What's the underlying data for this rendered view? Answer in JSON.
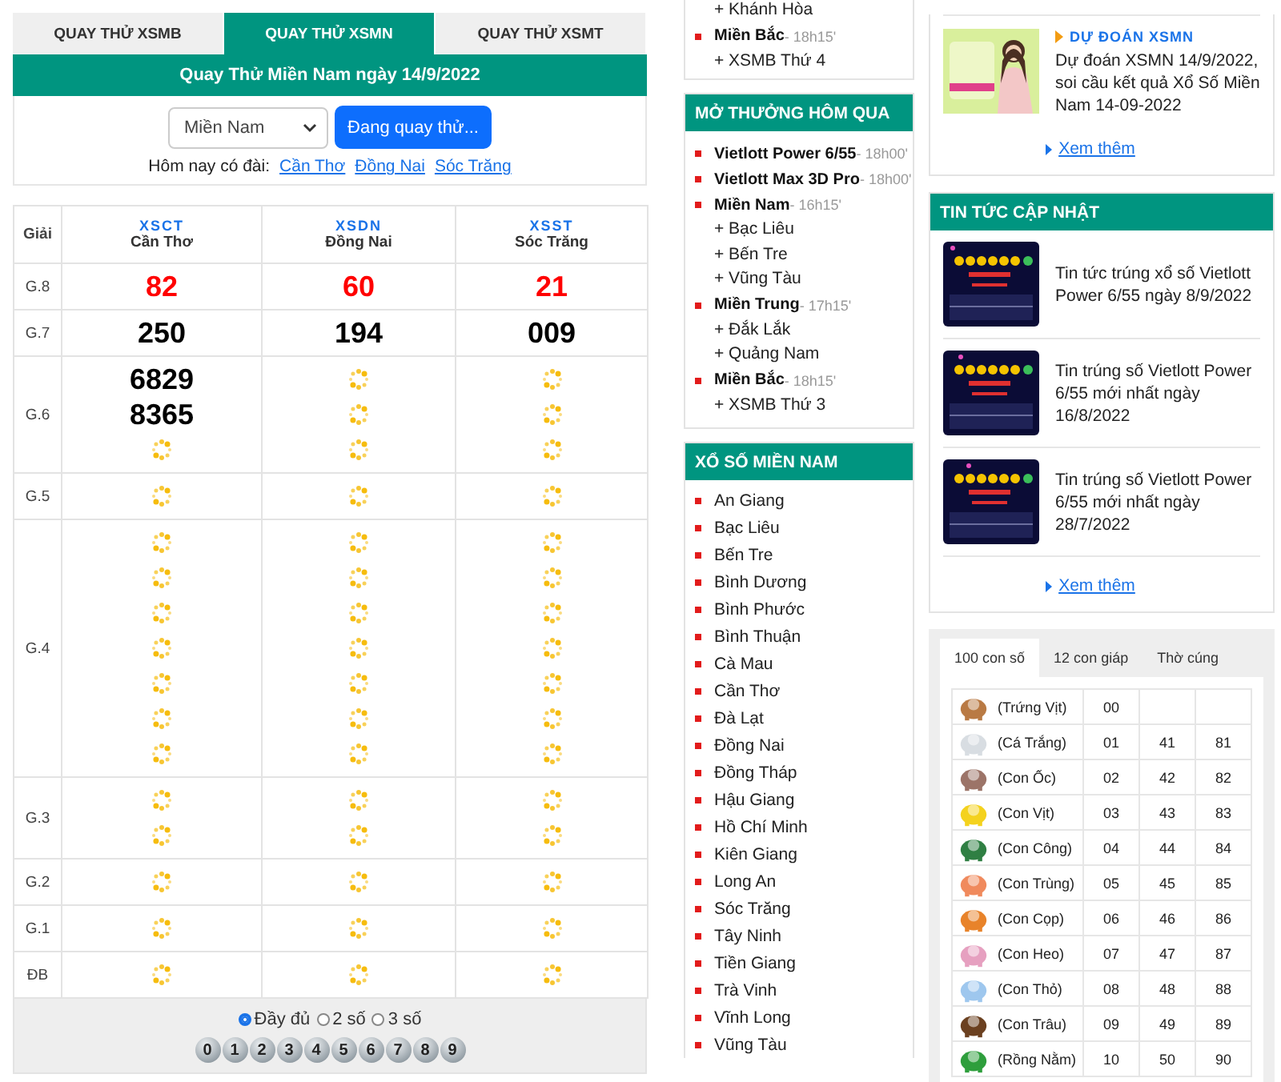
{
  "tabs": [
    {
      "label": "QUAY THỬ XSMB",
      "selected": false
    },
    {
      "label": "QUAY THỬ XSMN",
      "selected": true
    },
    {
      "label": "QUAY THỬ XSMT",
      "selected": false
    }
  ],
  "title": "Quay Thử Miền Nam ngày 14/9/2022",
  "region_select": {
    "value": "Miền Nam"
  },
  "spin_button": "Đang quay thử...",
  "today": {
    "label": "Hôm nay có đài:",
    "links": [
      "Cần Thơ",
      "Đồng Nai",
      "Sóc Trăng"
    ]
  },
  "results": {
    "corner": "Giải",
    "columns": [
      {
        "code": "XSCT",
        "name": "Cần Thơ"
      },
      {
        "code": "XSDN",
        "name": "Đồng Nai"
      },
      {
        "code": "XSST",
        "name": "Sóc Trăng"
      }
    ],
    "rows": [
      {
        "label": "G.8",
        "highlight": true,
        "cells": [
          [
            {
              "kind": "number",
              "text": "82"
            }
          ],
          [
            {
              "kind": "number",
              "text": "60"
            }
          ],
          [
            {
              "kind": "number",
              "text": "21"
            }
          ]
        ]
      },
      {
        "label": "G.7",
        "highlight": false,
        "cells": [
          [
            {
              "kind": "number",
              "text": "250"
            }
          ],
          [
            {
              "kind": "number",
              "text": "194"
            }
          ],
          [
            {
              "kind": "number",
              "text": "009"
            }
          ]
        ]
      },
      {
        "label": "G.6",
        "highlight": false,
        "cells": [
          [
            {
              "kind": "number",
              "text": "6829"
            },
            {
              "kind": "number",
              "text": "8365"
            },
            {
              "kind": "pending"
            }
          ],
          [
            {
              "kind": "pending"
            },
            {
              "kind": "pending"
            },
            {
              "kind": "pending"
            }
          ],
          [
            {
              "kind": "pending"
            },
            {
              "kind": "pending"
            },
            {
              "kind": "pending"
            }
          ]
        ]
      },
      {
        "label": "G.5",
        "highlight": false,
        "cells": [
          [
            {
              "kind": "pending"
            }
          ],
          [
            {
              "kind": "pending"
            }
          ],
          [
            {
              "kind": "pending"
            }
          ]
        ]
      },
      {
        "label": "G.4",
        "highlight": false,
        "cells": [
          [
            {
              "kind": "pending"
            },
            {
              "kind": "pending"
            },
            {
              "kind": "pending"
            },
            {
              "kind": "pending"
            },
            {
              "kind": "pending"
            },
            {
              "kind": "pending"
            },
            {
              "kind": "pending"
            }
          ],
          [
            {
              "kind": "pending"
            },
            {
              "kind": "pending"
            },
            {
              "kind": "pending"
            },
            {
              "kind": "pending"
            },
            {
              "kind": "pending"
            },
            {
              "kind": "pending"
            },
            {
              "kind": "pending"
            }
          ],
          [
            {
              "kind": "pending"
            },
            {
              "kind": "pending"
            },
            {
              "kind": "pending"
            },
            {
              "kind": "pending"
            },
            {
              "kind": "pending"
            },
            {
              "kind": "pending"
            },
            {
              "kind": "pending"
            }
          ]
        ]
      },
      {
        "label": "G.3",
        "highlight": false,
        "cells": [
          [
            {
              "kind": "pending"
            },
            {
              "kind": "pending"
            }
          ],
          [
            {
              "kind": "pending"
            },
            {
              "kind": "pending"
            }
          ],
          [
            {
              "kind": "pending"
            },
            {
              "kind": "pending"
            }
          ]
        ]
      },
      {
        "label": "G.2",
        "highlight": false,
        "cells": [
          [
            {
              "kind": "pending"
            }
          ],
          [
            {
              "kind": "pending"
            }
          ],
          [
            {
              "kind": "pending"
            }
          ]
        ]
      },
      {
        "label": "G.1",
        "highlight": false,
        "cells": [
          [
            {
              "kind": "pending"
            }
          ],
          [
            {
              "kind": "pending"
            }
          ],
          [
            {
              "kind": "pending"
            }
          ]
        ]
      },
      {
        "label": "ĐB",
        "highlight": false,
        "cells": [
          [
            {
              "kind": "pending"
            }
          ],
          [
            {
              "kind": "pending"
            }
          ],
          [
            {
              "kind": "pending"
            }
          ]
        ]
      }
    ]
  },
  "display_options": [
    {
      "label": "Đầy đủ",
      "selected": true
    },
    {
      "label": "2 số",
      "selected": false
    },
    {
      "label": "3 số",
      "selected": false
    }
  ],
  "digit_balls": [
    "0",
    "1",
    "2",
    "3",
    "4",
    "5",
    "6",
    "7",
    "8",
    "9"
  ],
  "schedule_today": {
    "groups": [
      {
        "children": [
          "+ Khánh Hòa"
        ]
      },
      {
        "title": "Miền Bắc",
        "time": "- 18h15'",
        "children": [
          "+ XSMB Thứ 4"
        ]
      }
    ]
  },
  "yesterday": {
    "heading": "MỞ THƯỞNG HÔM QUA",
    "groups": [
      {
        "title": "Vietlott Power 6/55",
        "time": "- 18h00'"
      },
      {
        "title": "Vietlott Max 3D Pro",
        "time": "- 18h00'"
      },
      {
        "title": "Miền Nam",
        "time": "- 16h15'",
        "children": [
          "+ Bạc Liêu",
          "+ Bến Tre",
          "+ Vũng Tàu"
        ]
      },
      {
        "title": "Miền Trung",
        "time": "- 17h15'",
        "children": [
          "+ Đắk Lắk",
          "+ Quảng Nam"
        ]
      },
      {
        "title": "Miền Bắc",
        "time": "- 18h15'",
        "children": [
          "+ XSMB Thứ 3"
        ]
      }
    ]
  },
  "south_lottery": {
    "heading": "XỔ SỐ MIỀN NAM",
    "items": [
      "An Giang",
      "Bạc Liêu",
      "Bến Tre",
      "Bình Dương",
      "Bình Phước",
      "Bình Thuận",
      "Cà Mau",
      "Cần Thơ",
      "Đà Lạt",
      "Đồng Nai",
      "Đồng Tháp",
      "Hậu Giang",
      "Hồ Chí Minh",
      "Kiên Giang",
      "Long An",
      "Sóc Trăng",
      "Tây Ninh",
      "Tiền Giang",
      "Trà Vinh",
      "Vĩnh Long",
      "Vũng Tàu"
    ]
  },
  "prediction": {
    "tag": "DỰ ĐOÁN XSMN",
    "title": "Dự đoán XSMN 14/9/2022, soi cầu kết quả Xổ Số Miền Nam 14-09-2022",
    "more": "Xem thêm"
  },
  "news": {
    "heading": "TIN TỨC CẬP NHẬT",
    "items": [
      "Tin tức trúng xổ số Vietlott Power 6/55 ngày 8/9/2022",
      "Tin trúng số Vietlott Power 6/55 mới nhất ngày 16/8/2022",
      "Tin trúng số Vietlott Power 6/55 mới nhất ngày 28/7/2022"
    ],
    "more": "Xem thêm"
  },
  "dream_tabs": [
    {
      "label": "100 con số",
      "selected": true
    },
    {
      "label": "12 con giáp",
      "selected": false
    },
    {
      "label": "Thờ cúng",
      "selected": false
    }
  ],
  "dream_rows": [
    {
      "name": "(Trứng Vịt)",
      "numbers": [
        "00"
      ]
    },
    {
      "name": "(Cá Trắng)",
      "numbers": [
        "01",
        "41",
        "81"
      ]
    },
    {
      "name": "(Con Ốc)",
      "numbers": [
        "02",
        "42",
        "82"
      ]
    },
    {
      "name": "(Con Vịt)",
      "numbers": [
        "03",
        "43",
        "83"
      ]
    },
    {
      "name": "(Con Công)",
      "numbers": [
        "04",
        "44",
        "84"
      ]
    },
    {
      "name": "(Con Trùng)",
      "numbers": [
        "05",
        "45",
        "85"
      ]
    },
    {
      "name": "(Con Cọp)",
      "numbers": [
        "06",
        "46",
        "86"
      ]
    },
    {
      "name": "(Con Heo)",
      "numbers": [
        "07",
        "47",
        "87"
      ]
    },
    {
      "name": "(Con Thỏ)",
      "numbers": [
        "08",
        "48",
        "88"
      ]
    },
    {
      "name": "(Con Trâu)",
      "numbers": [
        "09",
        "49",
        "89"
      ]
    },
    {
      "name": "(Rồng Nằm)",
      "numbers": [
        "10",
        "50",
        "90"
      ]
    }
  ]
}
